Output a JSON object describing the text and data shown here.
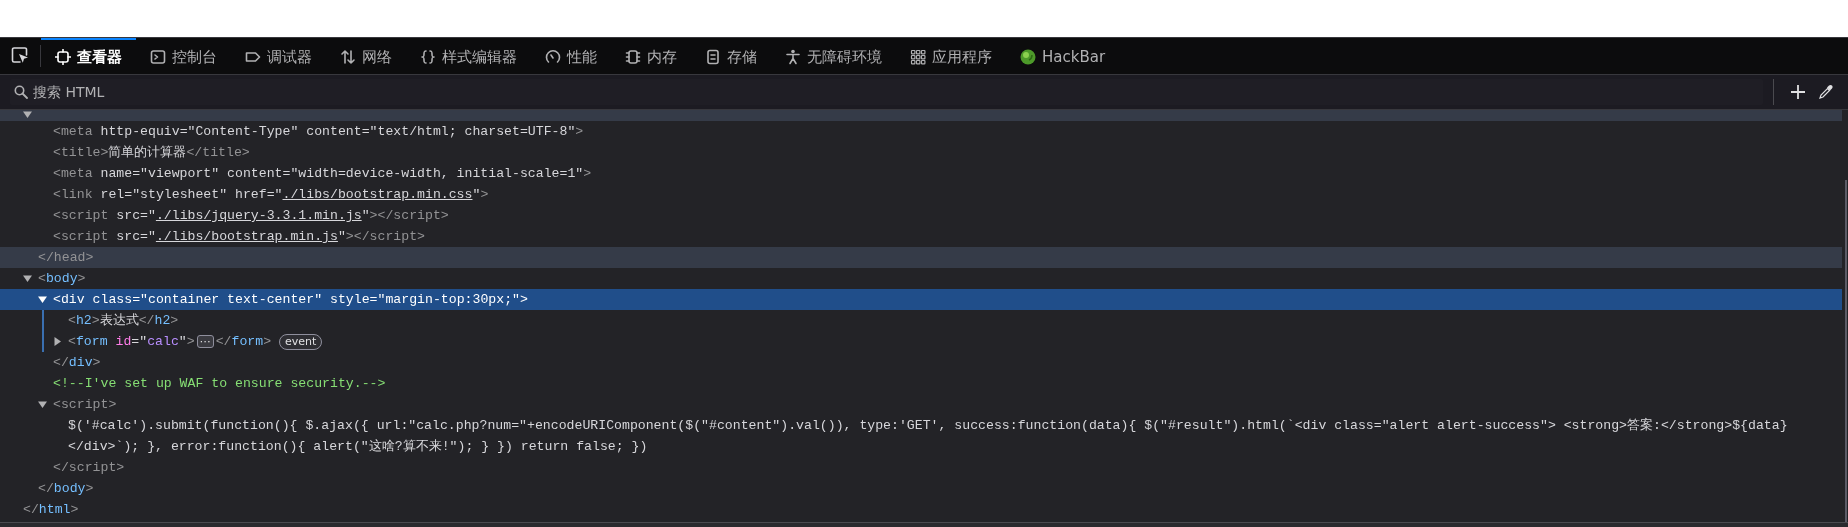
{
  "toolbar": {
    "tabs": [
      {
        "label": "查看器",
        "selected": true
      },
      {
        "label": "控制台",
        "selected": false
      },
      {
        "label": "调试器",
        "selected": false
      },
      {
        "label": "网络",
        "selected": false
      },
      {
        "label": "样式编辑器",
        "selected": false
      },
      {
        "label": "性能",
        "selected": false
      },
      {
        "label": "内存",
        "selected": false
      },
      {
        "label": "存储",
        "selected": false
      },
      {
        "label": "无障碍环境",
        "selected": false
      },
      {
        "label": "应用程序",
        "selected": false
      },
      {
        "label": "HackBar",
        "selected": false
      }
    ]
  },
  "search": {
    "placeholder": "搜索 HTML"
  },
  "tree": [
    {
      "expanded": true,
      "selected": false,
      "hovered": true,
      "dimmed": true,
      "children": [
        {
          "selected": false,
          "hovered": false,
          "dimmed": true,
          "open": [
            {
              "kind": "bracket",
              "text": "<"
            },
            {
              "kind": "tag",
              "text": "meta"
            },
            {
              "kind": "attr",
              "text": "http-equiv"
            },
            {
              "kind": "eq",
              "text": "=\""
            },
            {
              "kind": "value",
              "text": "Content-Type"
            },
            {
              "kind": "eq",
              "text": "\""
            },
            {
              "kind": "attr",
              "text": "content"
            },
            {
              "kind": "eq",
              "text": "=\""
            },
            {
              "kind": "value",
              "text": "text/html; charset=UTF-8"
            },
            {
              "kind": "eq",
              "text": "\""
            },
            {
              "kind": "bracket",
              "text": ">"
            }
          ]
        },
        {
          "selected": false,
          "hovered": false,
          "dimmed": true,
          "open": [
            {
              "kind": "bracket",
              "text": "<"
            },
            {
              "kind": "tag",
              "text": "title"
            },
            {
              "kind": "bracket",
              "text": ">"
            },
            {
              "kind": "text",
              "text": "简单的计算器"
            },
            {
              "kind": "bracket",
              "text": "</"
            },
            {
              "kind": "tag",
              "text": "title"
            },
            {
              "kind": "bracket",
              "text": ">"
            }
          ]
        },
        {
          "selected": false,
          "hovered": false,
          "dimmed": true,
          "open": [
            {
              "kind": "bracket",
              "text": "<"
            },
            {
              "kind": "tag",
              "text": "meta"
            },
            {
              "kind": "attr",
              "text": "name"
            },
            {
              "kind": "eq",
              "text": "=\""
            },
            {
              "kind": "value",
              "text": "viewport"
            },
            {
              "kind": "eq",
              "text": "\""
            },
            {
              "kind": "attr",
              "text": "content"
            },
            {
              "kind": "eq",
              "text": "=\""
            },
            {
              "kind": "value",
              "text": "width=device-width, initial-scale=1"
            },
            {
              "kind": "eq",
              "text": "\""
            },
            {
              "kind": "bracket",
              "text": ">"
            }
          ]
        },
        {
          "selected": false,
          "hovered": false,
          "dimmed": true,
          "open": [
            {
              "kind": "bracket",
              "text": "<"
            },
            {
              "kind": "tag",
              "text": "link"
            },
            {
              "kind": "attr",
              "text": "rel"
            },
            {
              "kind": "eq",
              "text": "=\""
            },
            {
              "kind": "value",
              "text": "stylesheet"
            },
            {
              "kind": "eq",
              "text": "\""
            },
            {
              "kind": "attr",
              "text": "href"
            },
            {
              "kind": "eq",
              "text": "=\""
            },
            {
              "kind": "link",
              "text": "./libs/bootstrap.min.css"
            },
            {
              "kind": "eq",
              "text": "\""
            },
            {
              "kind": "bracket",
              "text": ">"
            }
          ]
        },
        {
          "selected": false,
          "hovered": false,
          "dimmed": true,
          "open": [
            {
              "kind": "bracket",
              "text": "<"
            },
            {
              "kind": "tag",
              "text": "script"
            },
            {
              "kind": "attr",
              "text": "src"
            },
            {
              "kind": "eq",
              "text": "=\""
            },
            {
              "kind": "link",
              "text": "./libs/jquery-3.3.1.min.js"
            },
            {
              "kind": "eq",
              "text": "\""
            },
            {
              "kind": "bracket",
              "text": "></"
            },
            {
              "kind": "tag",
              "text": "script"
            },
            {
              "kind": "bracket",
              "text": ">"
            }
          ]
        },
        {
          "selected": false,
          "hovered": false,
          "dimmed": true,
          "open": [
            {
              "kind": "bracket",
              "text": "<"
            },
            {
              "kind": "tag",
              "text": "script"
            },
            {
              "kind": "attr",
              "text": "src"
            },
            {
              "kind": "eq",
              "text": "=\""
            },
            {
              "kind": "link",
              "text": "./libs/bootstrap.min.js"
            },
            {
              "kind": "eq",
              "text": "\""
            },
            {
              "kind": "bracket",
              "text": "></"
            },
            {
              "kind": "tag",
              "text": "script"
            },
            {
              "kind": "bracket",
              "text": ">"
            }
          ]
        }
      ],
      "close": [
        {
          "kind": "bracket",
          "text": "</"
        },
        {
          "kind": "tag",
          "text": "head"
        },
        {
          "kind": "bracket",
          "text": ">"
        }
      ]
    },
    {
      "expanded": true,
      "selected": false,
      "hovered": false,
      "dimmed": false,
      "open": [
        {
          "kind": "bracket",
          "text": "<"
        },
        {
          "kind": "tag",
          "text": "body"
        },
        {
          "kind": "bracket",
          "text": ">"
        }
      ],
      "children": [
        {
          "expanded": true,
          "selected": true,
          "hovered": false,
          "dimmed": false,
          "open": [
            {
              "kind": "bracket",
              "text": "<"
            },
            {
              "kind": "tag",
              "text": "div"
            },
            {
              "kind": "attr",
              "text": "class"
            },
            {
              "kind": "eq",
              "text": "=\""
            },
            {
              "kind": "value",
              "text": "container text-center"
            },
            {
              "kind": "eq",
              "text": "\""
            },
            {
              "kind": "attr",
              "text": "style"
            },
            {
              "kind": "eq",
              "text": "=\""
            },
            {
              "kind": "value",
              "text": "margin-top:30px;"
            },
            {
              "kind": "eq",
              "text": "\""
            },
            {
              "kind": "bracket",
              "text": ">"
            }
          ],
          "children": [
            {
              "selected": false,
              "hovered": false,
              "dimmed": false,
              "open": [
                {
                  "kind": "bracket",
                  "text": "<"
                },
                {
                  "kind": "tag",
                  "text": "h2"
                },
                {
                  "kind": "bracket",
                  "text": ">"
                },
                {
                  "kind": "text",
                  "text": "表达式"
                },
                {
                  "kind": "bracket",
                  "text": "</"
                },
                {
                  "kind": "tag",
                  "text": "h2"
                },
                {
                  "kind": "bracket",
                  "text": ">"
                }
              ]
            },
            {
              "expanded": false,
              "selected": false,
              "hovered": false,
              "dimmed": false,
              "open": [
                {
                  "kind": "bracket",
                  "text": "<"
                },
                {
                  "kind": "tag",
                  "text": "form"
                },
                {
                  "kind": "attr",
                  "text": "id"
                },
                {
                  "kind": "eq",
                  "text": "=\""
                },
                {
                  "kind": "value",
                  "text": "calc"
                },
                {
                  "kind": "eq",
                  "text": "\""
                },
                {
                  "kind": "bracket",
                  "text": ">"
                },
                {
                  "kind": "ellipsis",
                  "text": "⋯"
                },
                {
                  "kind": "bracket",
                  "text": "</"
                },
                {
                  "kind": "tag",
                  "text": "form"
                },
                {
                  "kind": "bracket",
                  "text": ">"
                },
                {
                  "kind": "badge",
                  "text": "event"
                }
              ]
            }
          ],
          "close": [
            {
              "kind": "bracket",
              "text": "</"
            },
            {
              "kind": "tag",
              "text": "div"
            },
            {
              "kind": "bracket",
              "text": ">"
            }
          ]
        },
        {
          "selected": false,
          "hovered": false,
          "dimmed": false,
          "open": [
            {
              "kind": "comment",
              "text": "<!--I've set up WAF to ensure security.-->"
            }
          ]
        },
        {
          "expanded": true,
          "selected": false,
          "hovered": false,
          "dimmed": true,
          "open": [
            {
              "kind": "bracket",
              "text": "<"
            },
            {
              "kind": "tag",
              "text": "script"
            },
            {
              "kind": "bracket",
              "text": ">"
            }
          ],
          "children": [
            {
              "selected": false,
              "hovered": false,
              "kind": "text",
              "text": "$('#calc').submit(function(){ $.ajax({ url:\"calc.php?num=\"+encodeURIComponent($(\"#content\").val()), type:'GET', success:function(data){ $(\"#result\").html(`<div class=\"alert alert-success\"> <strong>答案:</strong>${data} </div>`); }, error:function(){ alert(\"这啥?算不来!\"); } }) return false; })"
            }
          ],
          "close": [
            {
              "kind": "bracket",
              "text": "</"
            },
            {
              "kind": "tag",
              "text": "script"
            },
            {
              "kind": "bracket",
              "text": ">"
            }
          ]
        }
      ],
      "close": [
        {
          "kind": "bracket",
          "text": "</"
        },
        {
          "kind": "tag",
          "text": "body"
        },
        {
          "kind": "bracket",
          "text": ">"
        }
      ]
    },
    {
      "selected": false,
      "hovered": false,
      "dimmed": false,
      "close": [
        {
          "kind": "bracket",
          "text": "</"
        },
        {
          "kind": "tag",
          "text": "html"
        },
        {
          "kind": "bracket",
          "text": ">"
        }
      ]
    }
  ]
}
